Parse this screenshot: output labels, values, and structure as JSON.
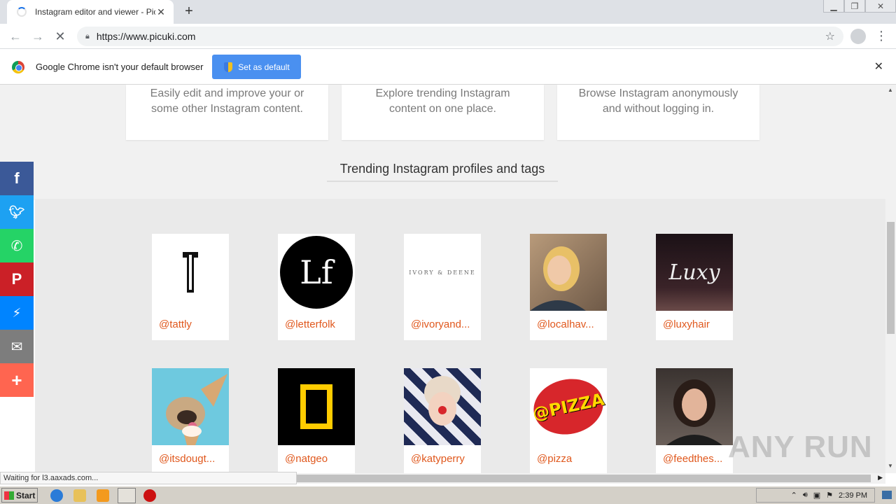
{
  "browser": {
    "tab_title": "Instagram editor and viewer - Picuki",
    "url": "https://www.picuki.com",
    "new_tab_label": "+"
  },
  "infobar": {
    "message": "Google Chrome isn't your default browser",
    "button_label": "Set as default"
  },
  "features": [
    {
      "text": "Easily edit and improve your or some other Instagram content."
    },
    {
      "text": "Explore trending Instagram content on one place."
    },
    {
      "text": "Browse Instagram anonymously and without logging in."
    }
  ],
  "section_title": "Trending Instagram profiles and tags",
  "profiles": [
    {
      "handle": "@tattly"
    },
    {
      "handle": "@letterfolk"
    },
    {
      "handle": "@ivoryand..."
    },
    {
      "handle": "@localhav..."
    },
    {
      "handle": "@luxyhair"
    },
    {
      "handle": "@itsdougt..."
    },
    {
      "handle": "@natgeo"
    },
    {
      "handle": "@katyperry"
    },
    {
      "handle": "@pizza"
    },
    {
      "handle": "@feedthes..."
    }
  ],
  "thumb_text": {
    "letterfolk": "Lf",
    "ivory": "IVORY & DEENE",
    "luxy": "Luxy",
    "pizza": "@PIZZA"
  },
  "status_text": "Waiting for l3.aaxads.com...",
  "watermark": "ANY RUN",
  "taskbar": {
    "start_label": "Start",
    "clock": "2:39 PM"
  },
  "colors": {
    "facebook": "#3b5998",
    "twitter": "#1da1f2",
    "whatsapp": "#25d366",
    "pinterest": "#cb2027",
    "messenger": "#0084ff",
    "email": "#7d7d7d",
    "more": "#ff6550",
    "handle": "#e0581d"
  }
}
